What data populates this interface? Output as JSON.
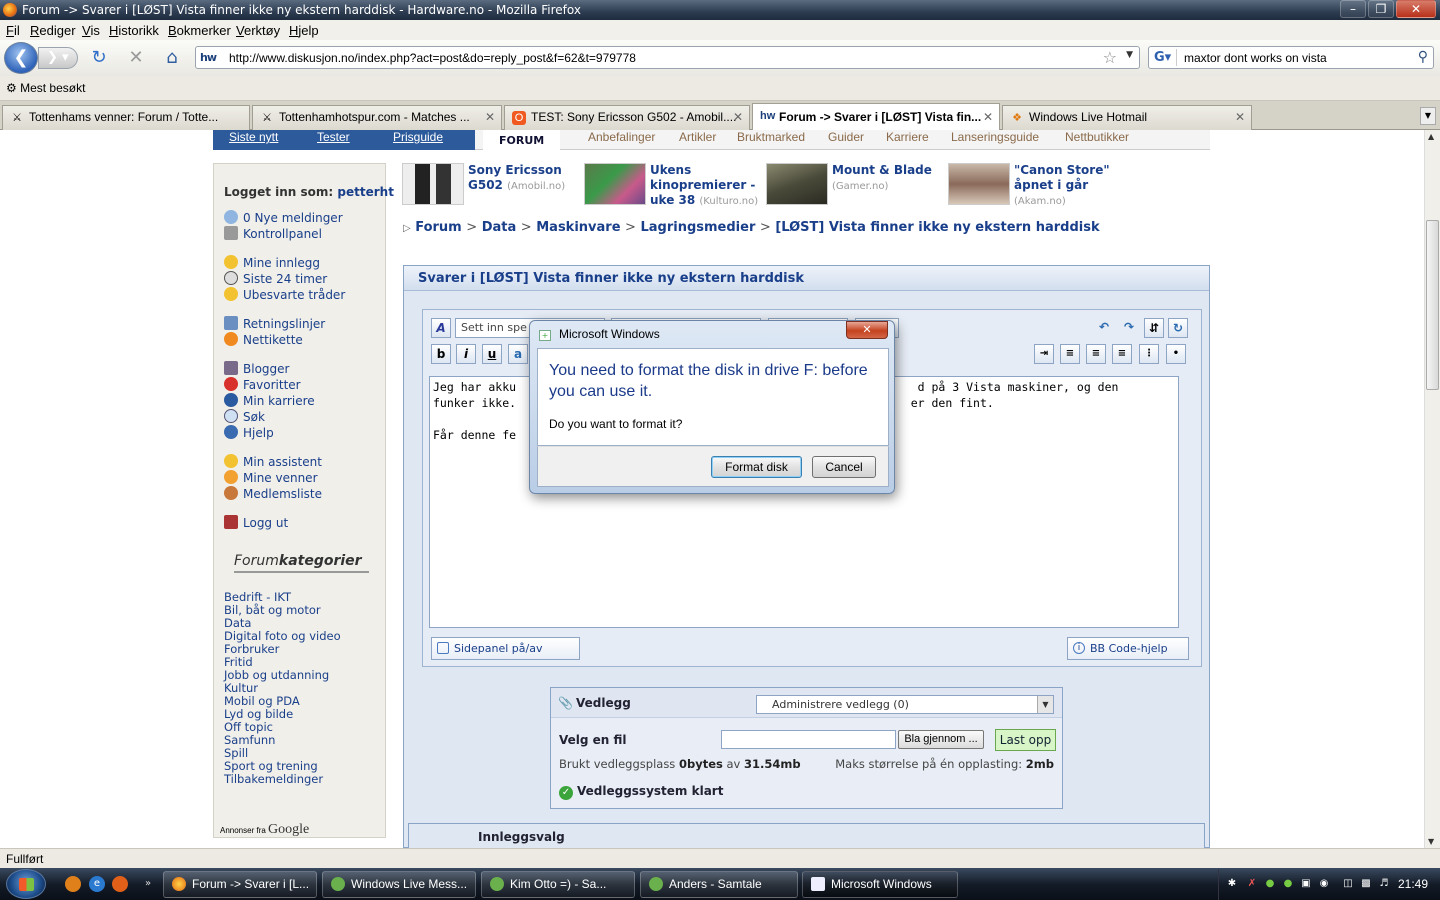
{
  "window": {
    "title": "Forum -> Svarer i [LØST] Vista finner ikke ny ekstern harddisk - Hardware.no - Mozilla Firefox"
  },
  "menu": [
    "Fil",
    "Rediger",
    "Vis",
    "Historikk",
    "Bokmerker",
    "Verktøy",
    "Hjelp"
  ],
  "nav": {
    "url": "http://www.diskusjon.no/index.php?act=post&do=reply_post&f=62&t=979778",
    "search_query": "maxtor dont works on vista"
  },
  "bookmarks": {
    "most_visited": "Mest besøkt"
  },
  "tabs": [
    {
      "label": "Tottenhams venner: Forum / Totte...",
      "icon": "spurs-icon"
    },
    {
      "label": "Tottenhamhotspur.com - Matches ...",
      "icon": "spurs-icon"
    },
    {
      "label": "TEST: Sony Ericsson G502 - Amobil....",
      "icon": "amobil-icon"
    },
    {
      "label": "Forum -> Svarer i [LØST] Vista fin...",
      "icon": "hw-icon",
      "active": true
    },
    {
      "label": "Windows Live Hotmail",
      "icon": "windows-icon"
    }
  ],
  "topnav": {
    "left": [
      "Siste nytt",
      "Tester",
      "Prisguide"
    ],
    "forum": "FORUM",
    "links": [
      "Anbefalinger",
      "Artikler",
      "Bruktmarked",
      "Guider",
      "Karriere",
      "Lanseringsguide",
      "Nettbutikker"
    ]
  },
  "sidebar": {
    "login_label": "Logget inn som:",
    "username": "petterht",
    "links": [
      "0 Nye meldinger",
      "Kontrollpanel",
      "Mine innlegg",
      "Siste 24 timer",
      "Ubesvarte tråder",
      "Retningslinjer",
      "Nettikette",
      "Blogger",
      "Favoritter",
      "Min karriere",
      "Søk",
      "Hjelp",
      "Min assistent",
      "Mine venner",
      "Medlemsliste",
      "Logg ut"
    ],
    "category_title_a": "Forum",
    "category_title_b": "kategorier",
    "categories": [
      "Bedrift - IKT",
      "Bil, båt og motor",
      "Data",
      "Digital foto og video",
      "Forbruker",
      "Fritid",
      "Jobb og utdanning",
      "Kultur",
      "Mobil og PDA",
      "Lyd og bilde",
      "Off topic",
      "Samfunn",
      "Spill",
      "Sport og trening",
      "Tilbakemeldinger"
    ],
    "ads_label": "Annonser fra",
    "ads_brand": "Google"
  },
  "news": [
    {
      "line1": "Sony Ericsson",
      "line2": "G502",
      "line3": "",
      "source": "(Amobil.no)"
    },
    {
      "line1": "Ukens",
      "line2": "kinopremierer -",
      "line3": "uke 38",
      "source": "(Kulturo.no)"
    },
    {
      "line1": "Mount & Blade",
      "line2": "",
      "line3": "",
      "source": "(Gamer.no)"
    },
    {
      "line1": "\"Canon Store\"",
      "line2": "åpnet i går",
      "line3": "",
      "source": "(Akam.no)"
    }
  ],
  "breadcrumb": [
    "Forum",
    "Data",
    "Maskinvare",
    "Lagringsmedier",
    "[LØST] Vista finner ikke ny ekstern harddisk"
  ],
  "reply": {
    "header": "Svarer i [LØST] Vista finner ikke ny ekstern harddisk",
    "special_placeholder": "Sett inn spe",
    "text": "Jeg har akku                                                          d på 3 Vista maskiner, og den\nfunker ikke.                                                         er den fint.\n\nFår denne fe",
    "sidepanel_btn": "Sidepanel på/av",
    "bbcode_btn": "BB Code-hjelp"
  },
  "attachments": {
    "title": "Vedlegg",
    "manage": "Administrere vedlegg (0)",
    "choose_file": "Velg en fil",
    "browse": "Bla gjennom ...",
    "upload": "Last opp",
    "used_label": "Brukt vedleggsplass",
    "used_value": "0bytes",
    "of_label": "av",
    "total_value": "31.54mb",
    "max_label": "Maks størrelse på én opplasting:",
    "max_value": "2mb",
    "status": "Vedleggssystem klart"
  },
  "post_options": "Innleggsvalg",
  "dialog": {
    "title": "Microsoft Windows",
    "message": "You need to format the disk in drive F: before you can use it.",
    "question": "Do you want to format it?",
    "format_btn": "Format disk",
    "cancel_btn": "Cancel"
  },
  "status": "Fullført",
  "taskbar": {
    "items": [
      "Forum -> Svarer i [L...",
      "Windows Live Mess...",
      "Kim Otto =) - Sa...",
      "Anders - Samtale",
      "Microsoft Windows"
    ],
    "clock": "21:49"
  }
}
